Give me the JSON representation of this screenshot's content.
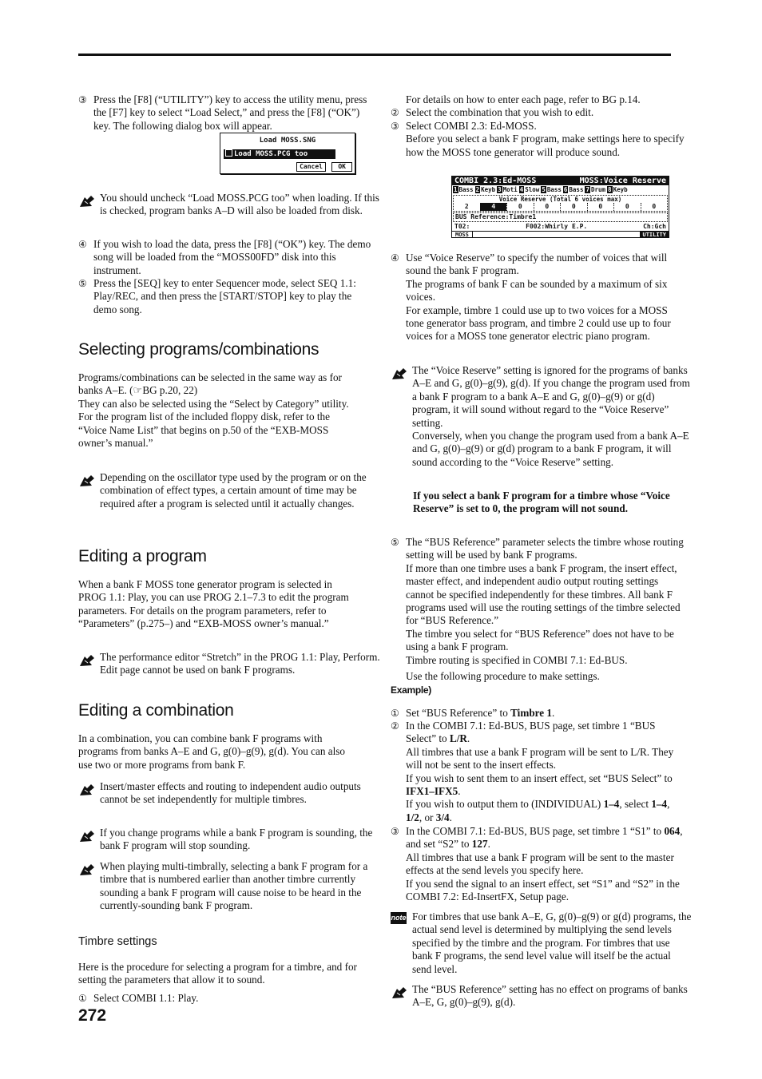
{
  "page_number": "272",
  "left": [
    {
      "kind": "step",
      "num": "③",
      "paras": [
        [
          "Press the [F8] (“UTILITY”) key to access the utility menu, press the [F7] key to select “Load Select,” and press the [F8] (“OK”) key. The following dialog box will appear."
        ]
      ]
    },
    {
      "kind": "lcd1"
    },
    {
      "kind": "caution",
      "paras": [
        [
          "You should uncheck “Load MOSS.PCG too” when loading. If this is checked, program banks A–D will also be loaded from disk."
        ]
      ]
    },
    {
      "kind": "step",
      "num": "④",
      "paras": [
        [
          "If you wish to load the data, press the [F8] (“OK”) key. The demo song will be loaded from the “MOSS00FD” disk into this instrument."
        ]
      ]
    },
    {
      "kind": "step",
      "num": "⑤",
      "paras": [
        [
          "Press the [SEQ] key to enter Sequencer mode, select SEQ 1.1: Play/REC, and then press the [START/STOP] key to play the demo song."
        ]
      ]
    },
    {
      "kind": "h2",
      "text": "Selecting programs/combinations"
    },
    {
      "kind": "text",
      "paras": [
        [
          "Programs/combinations can be selected in the same way as for banks A–E. (☞BG p.20, 22)"
        ],
        [
          "They can also be selected using the “Select by Category” utility."
        ],
        [
          "For the program list of the included floppy disk, refer to the “Voice Name List” that begins on p.50 of the “EXB-MOSS owner’s manual.”"
        ]
      ]
    },
    {
      "kind": "caution",
      "paras": [
        [
          "Depending on the oscillator type used by the program or on the combination of effect types, a certain amount of time may be required after a program is selected until it actually changes."
        ]
      ]
    },
    {
      "kind": "h2",
      "text": "Editing a program"
    },
    {
      "kind": "text",
      "paras": [
        [
          "When a bank F MOSS tone generator program is selected in PROG 1.1: Play, you can use PROG 2.1–7.3 to edit the program parameters. For details on the program parameters, refer to “Parameters” (p.275–) and “EXB-MOSS owner’s manual.”"
        ]
      ]
    },
    {
      "kind": "caution",
      "paras": [
        [
          "The performance editor “Stretch” in the PROG 1.1: Play, Perform. Edit page cannot be used on bank F programs."
        ]
      ]
    },
    {
      "kind": "h2",
      "text": "Editing a combination"
    },
    {
      "kind": "text",
      "paras": [
        [
          "In a combination, you can combine bank F programs with programs from banks A–E and G, g(0)–g(9), g(d). You can also use two or more programs from bank F."
        ]
      ]
    },
    {
      "kind": "caution",
      "paras": [
        [
          "Insert/master effects and routing to independent audio outputs cannot be set independently for multiple timbres."
        ]
      ]
    },
    {
      "kind": "caution",
      "paras": [
        [
          "If you change programs while a bank F program is sounding, the bank F program will stop sounding."
        ]
      ]
    },
    {
      "kind": "caution",
      "paras": [
        [
          "When playing multi-timbrally, selecting a bank F program for a timbre that is numbered earlier than another timbre currently sounding a bank F program will cause noise to be heard in the currently-sounding bank F program."
        ]
      ]
    },
    {
      "kind": "h3",
      "text": "Timbre settings"
    },
    {
      "kind": "text",
      "paras": [
        [
          "Here is the procedure for selecting a program for a timbre, and for setting the parameters that allow it to sound."
        ]
      ]
    },
    {
      "kind": "step",
      "num": "①",
      "paras": [
        [
          "Select COMBI 1.1: Play."
        ]
      ]
    }
  ],
  "right": [
    {
      "kind": "indent",
      "paras": [
        [
          "For details on how to enter each page, refer to BG p.14."
        ]
      ]
    },
    {
      "kind": "step",
      "num": "②",
      "paras": [
        [
          "Select the combination that you wish to edit."
        ]
      ]
    },
    {
      "kind": "step",
      "num": "③",
      "paras": [
        [
          "Select COMBI 2.3: Ed-MOSS."
        ],
        [
          "Before you select a bank F program, make settings here to specify how the MOSS tone generator will produce sound."
        ]
      ]
    },
    {
      "kind": "lcd2"
    },
    {
      "kind": "step",
      "num": "④",
      "paras": [
        [
          "Use “Voice Reserve” to specify the number of voices that will sound the bank F program."
        ],
        [
          "The programs of bank F can be sounded by a maximum of six voices."
        ],
        [
          "For example, timbre 1 could use up to two voices for a MOSS tone generator bass program, and timbre 2 could use up to four voices for a MOSS tone generator electric piano program."
        ]
      ]
    },
    {
      "kind": "caution",
      "paras": [
        [
          "The “Voice Reserve” setting is ignored for the programs of banks A–E and G, g(0)–g(9), g(d). If you change the program used from a bank F program to a bank A–E and G, g(0)–g(9) or g(d) program, it will sound without regard to the “Voice Reserve” setting."
        ],
        [
          "Conversely, when you change the program used from a bank A–E and G, g(0)–g(9) or g(d) program to a bank F program, it will sound according to the “Voice Reserve” setting."
        ]
      ]
    },
    {
      "kind": "boldindent",
      "paras": [
        [
          {
            "b": "If you select a bank F program for a timbre whose “Voice Reserve” is set to 0, the program will not sound."
          }
        ]
      ]
    },
    {
      "kind": "step",
      "num": "⑤",
      "paras": [
        [
          "The “BUS Reference” parameter selects the timbre whose routing setting will be used by bank F programs."
        ],
        [
          "If more than one timbre uses a bank F program, the insert effect, master effect, and independent audio output routing settings cannot be specified independently for these timbres. All bank F programs used will use the routing settings of the timbre selected for “BUS Reference.”"
        ],
        [
          "The timbre you select for “BUS Reference” does not have to be using a bank F program."
        ],
        [
          "Timbre routing is specified in COMBI 7.1: Ed-BUS."
        ]
      ]
    },
    {
      "kind": "indent",
      "paras": [
        [
          "Use the following procedure to make settings."
        ]
      ]
    },
    {
      "kind": "example",
      "text": "Example)"
    },
    {
      "kind": "step",
      "num": "①",
      "paras": [
        [
          "Set “BUS Reference” to ",
          {
            "b": "Timbre 1"
          },
          "."
        ]
      ]
    },
    {
      "kind": "step",
      "num": "②",
      "paras": [
        [
          "In the COMBI 7.1: Ed-BUS, BUS page, set timbre 1 “BUS Select” to ",
          {
            "b": "L/R"
          },
          "."
        ],
        [
          "All timbres that use a bank F program will be sent to L/R. They will not be sent to the insert effects."
        ],
        [
          "If you wish to sent them to an insert effect, set “BUS Select” to ",
          {
            "b": "IFX1–IFX5"
          },
          "."
        ],
        [
          "If you wish to output them to (INDIVIDUAL) ",
          {
            "b": "1–4"
          },
          ", select ",
          {
            "b": "1–4"
          },
          ", ",
          {
            "b": "1/2"
          },
          ", or ",
          {
            "b": "3/4"
          },
          "."
        ]
      ]
    },
    {
      "kind": "step",
      "num": "③",
      "paras": [
        [
          "In the COMBI 7.1: Ed-BUS, BUS page, set timbre 1 “S1” to ",
          {
            "b": "064"
          },
          ", and set “S2” to ",
          {
            "b": "127"
          },
          "."
        ],
        [
          "All timbres that use a bank F program will be sent to the master effects at the send levels you specify here."
        ],
        [
          "If you send the signal to an insert effect, set “S1” and “S2” in the COMBI 7.2: Ed-InsertFX, Setup page."
        ]
      ]
    },
    {
      "kind": "note",
      "icon_label": "note",
      "paras": [
        [
          "For timbres that use bank A–E, G, g(0)–g(9) or g(d) programs, the actual send level is determined by multiplying the send levels specified by the timbre and the program. For timbres that use bank F programs, the send level value will itself be the actual send level."
        ]
      ]
    },
    {
      "kind": "caution",
      "paras": [
        [
          "The “BUS Reference” setting has no effect on programs of banks A–E, G, g(0)–g(9), g(d)."
        ]
      ]
    }
  ],
  "lcd1": {
    "title": "Load  MOSS.SNG",
    "checkbox_label": "Load  MOSS.PCG too",
    "checked": false,
    "cancel": "Cancel",
    "ok": "OK"
  },
  "lcd2": {
    "title": "COMBI 2.3:Ed-MOSS",
    "page": "MOSS:Voice Reserve",
    "timbres": [
      {
        "n": "1",
        "p": "Bass"
      },
      {
        "n": "2",
        "p": "Keyb"
      },
      {
        "n": "3",
        "p": "Moti"
      },
      {
        "n": "4",
        "p": "Slow"
      },
      {
        "n": "5",
        "p": "Bass"
      },
      {
        "n": "6",
        "p": "Bass"
      },
      {
        "n": "7",
        "p": "Drum"
      },
      {
        "n": "8",
        "p": "Keyb"
      }
    ],
    "vr_label": "Voice Reserve (Total 6 voices max)",
    "values": [
      "2",
      "4",
      "0",
      "0",
      "0",
      "0",
      "0",
      "0"
    ],
    "selected_index": 1,
    "bus": "BUS Reference:Timbre1",
    "timbre": "T02:",
    "program": "F002:Whirly E.P.",
    "channel": "Ch:Gch",
    "tab": "MOSS",
    "utility": "UTILITY"
  }
}
